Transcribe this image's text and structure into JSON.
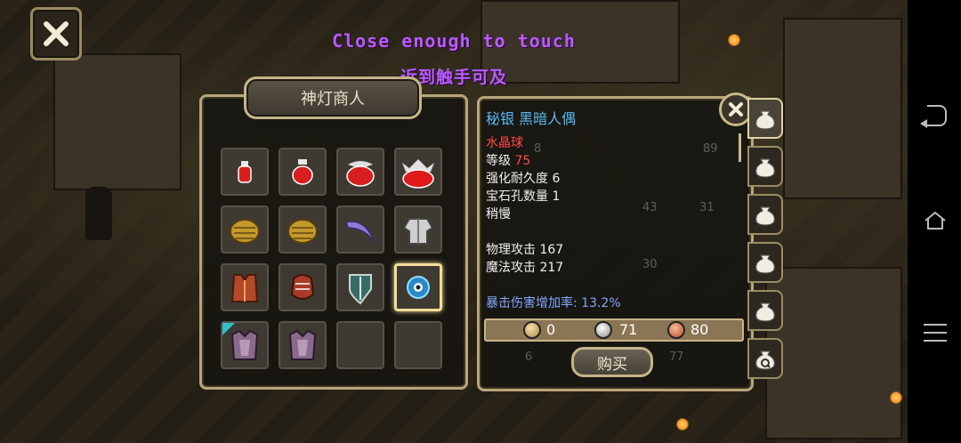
{
  "banner": {
    "english": "Close enough to touch",
    "chinese": "近到触手可及"
  },
  "shop": {
    "title": "神灯商人",
    "items": [
      {
        "icon": "small-hp-potion-icon"
      },
      {
        "icon": "medium-hp-potion-icon"
      },
      {
        "icon": "large-hp-potion-icon"
      },
      {
        "icon": "huge-hp-potion-icon"
      },
      {
        "icon": "gold-gauntlet-icon"
      },
      {
        "icon": "gold-gauntlet-icon"
      },
      {
        "icon": "purple-scythe-blade-icon"
      },
      {
        "icon": "silver-armor-icon"
      },
      {
        "icon": "leather-vest-icon"
      },
      {
        "icon": "red-glove-icon"
      },
      {
        "icon": "teal-shield-icon"
      },
      {
        "icon": "crystal-ball-icon",
        "selected": true
      },
      {
        "icon": "pink-robe-icon",
        "rare": true
      },
      {
        "icon": "pink-robe-icon"
      },
      {
        "icon": "empty-slot-icon"
      },
      {
        "icon": "empty-slot-icon"
      }
    ]
  },
  "detail": {
    "name": "秘银 黑暗人偶",
    "type": "水晶球",
    "level_label": "等级",
    "level_value": "75",
    "durability": "强化耐久度 6",
    "gem_slots": "宝石孔数量 1",
    "speed": "稍慢",
    "phys_attack": "物理攻击 167",
    "magic_attack": "魔法攻击 217",
    "crit": "暴击伤害增加率: 13.2%",
    "price": {
      "gold": "0",
      "silver": "71",
      "copper": "80"
    },
    "buy_label": "购买",
    "background_counts": [
      "89",
      "43",
      "31",
      "30",
      "6",
      "77",
      "8"
    ]
  },
  "bag_tabs": [
    "bag-icon",
    "bag-icon",
    "bag-icon",
    "bag-icon",
    "bag-icon",
    "bag-icon"
  ],
  "colors": {
    "banner": "#b85cff",
    "item_name": "#58b8f0",
    "warning": "#ff4a4a",
    "crit": "#80a8ff",
    "frame": "#b8a67c"
  }
}
